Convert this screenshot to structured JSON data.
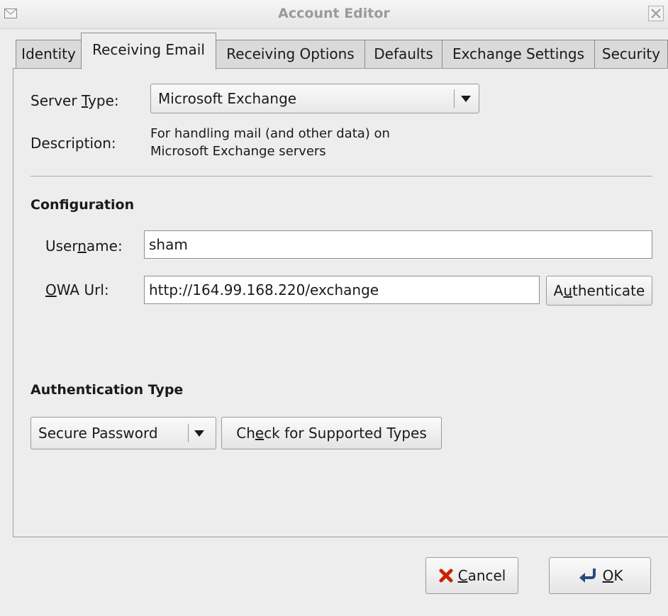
{
  "window": {
    "title": "Account Editor",
    "icons": [
      "mail-icon",
      "close-icon"
    ]
  },
  "tabs": [
    {
      "label": "Identity"
    },
    {
      "label": "Receiving Email"
    },
    {
      "label": "Receiving Options"
    },
    {
      "label": "Defaults"
    },
    {
      "label": "Exchange Settings"
    },
    {
      "label": "Security"
    }
  ],
  "active_tab": "Receiving Email",
  "server": {
    "type_label_before": "Server ",
    "type_label_mnemonic": "T",
    "type_label_after": "ype:",
    "type_value": "Microsoft Exchange",
    "description_label": "Description:",
    "description_line1": "For handling mail (and other data) on",
    "description_line2": "Microsoft Exchange servers"
  },
  "configuration": {
    "heading": "Configuration",
    "username_label_before": "User",
    "username_label_mnemonic": "n",
    "username_label_after": "ame:",
    "username_value": "sham",
    "owa_label_mnemonic": "O",
    "owa_label_after": "WA Url:",
    "owa_value": "http://164.99.168.220/exchange",
    "authenticate_before": "A",
    "authenticate_mnemonic": "u",
    "authenticate_after": "thenticate"
  },
  "authentication": {
    "heading": "Authentication Type",
    "type_value": "Secure Password",
    "check_before": "Ch",
    "check_mnemonic": "e",
    "check_after": "ck for Supported Types"
  },
  "buttons": {
    "cancel_mnemonic": "C",
    "cancel_after": "ancel",
    "ok_mnemonic": "O",
    "ok_after": "K",
    "cancel_icon": "cancel-x-icon",
    "ok_icon": "ok-return-icon"
  },
  "colors": {
    "cancel_icon": "#cc2200",
    "ok_icon": "#2a4a7a"
  }
}
